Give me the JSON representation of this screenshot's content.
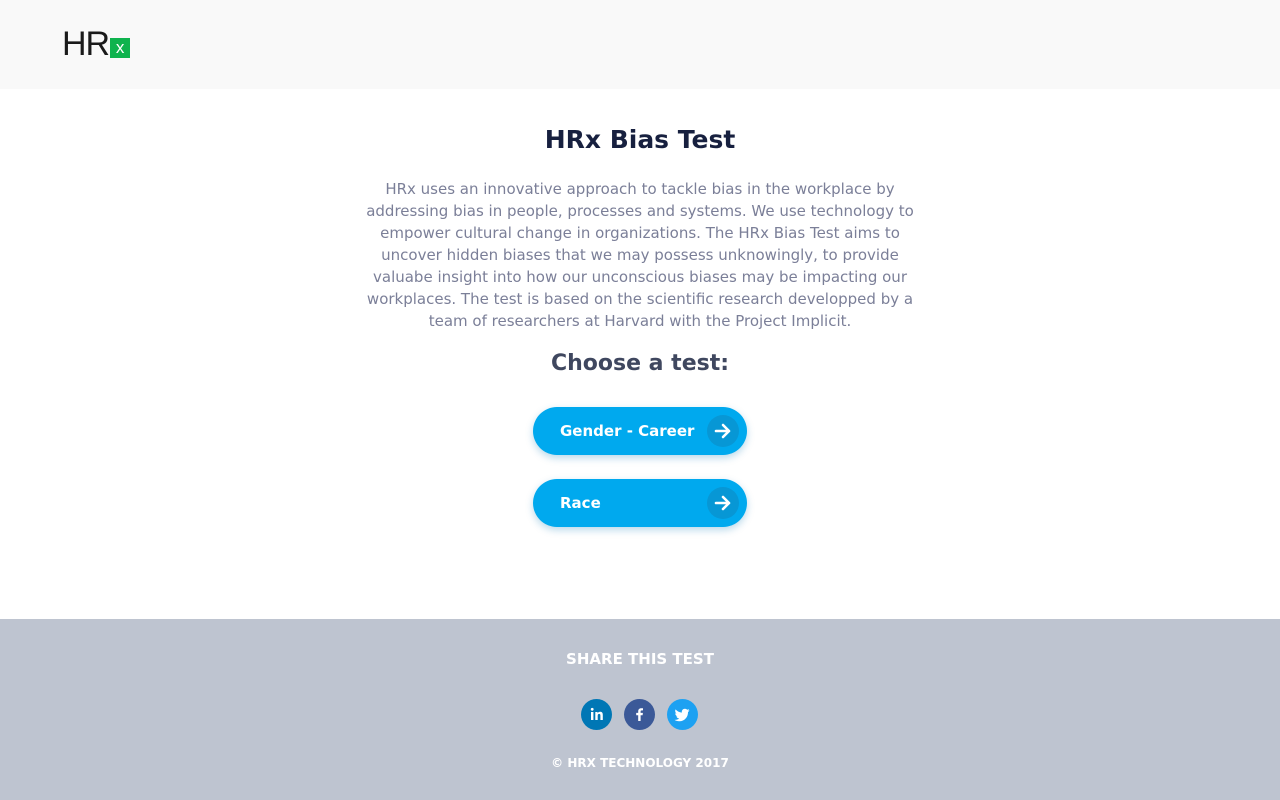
{
  "header": {
    "logo_text": "HR",
    "logo_mark": "x"
  },
  "main": {
    "title": "HRx Bias Test",
    "intro": "HRx uses an innovative approach to tackle bias in the workplace by addressing bias in people, processes and systems. We use technology to empower cultural change in organizations. The HRx Bias Test aims to uncover hidden biases that we may possess unknowingly, to provide valuabe insight into how our unconscious biases may be impacting our workplaces. The test is based on the scientific research developped by a team of researchers at Harvard with the Project Implicit.",
    "choose_label": "Choose a test:",
    "tests": [
      {
        "label": "Gender - Career",
        "icon": "arrow-right-icon"
      },
      {
        "label": "Race",
        "icon": "arrow-right-icon"
      }
    ]
  },
  "footer": {
    "share_title": "SHARE THIS TEST",
    "social": [
      {
        "name": "linkedin",
        "glyph": "in",
        "color": "#0077b5"
      },
      {
        "name": "facebook",
        "glyph": "f",
        "color": "#3b5998"
      },
      {
        "name": "twitter",
        "glyph": "twitter-bird",
        "color": "#1da1f2"
      }
    ],
    "copyright": "© HRX TECHNOLOGY 2017"
  },
  "colors": {
    "accent": "#00a9ee",
    "logo_green": "#0fb34e",
    "title": "#17203f",
    "body_text": "#7b7f98",
    "footer_bg": "#bec4d0",
    "header_bg": "#f9f9f9"
  }
}
